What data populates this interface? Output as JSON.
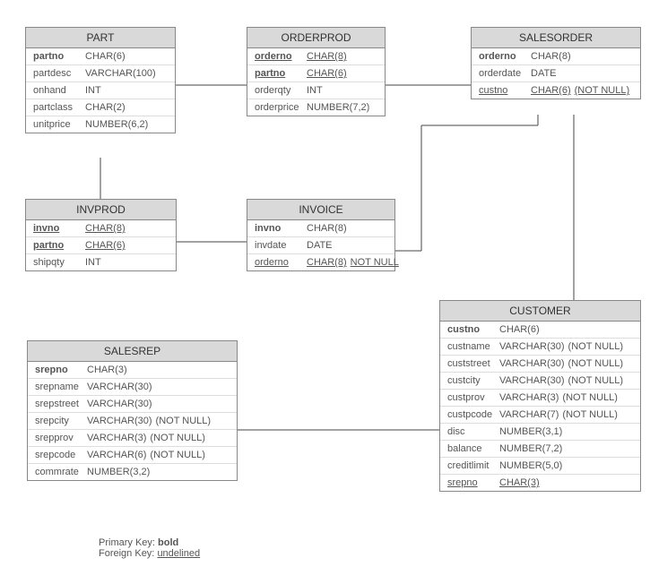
{
  "legend": {
    "pk_label": "Primary Key:",
    "pk_style": "bold",
    "fk_label": "Foreign Key:",
    "fk_style": "undelined"
  },
  "entities": {
    "part": {
      "title": "PART",
      "rows": [
        {
          "name": "partno",
          "type": "CHAR(6)",
          "extra": "",
          "pk": true,
          "fk": false
        },
        {
          "name": "partdesc",
          "type": "VARCHAR(100)",
          "extra": "",
          "pk": false,
          "fk": false
        },
        {
          "name": "onhand",
          "type": "INT",
          "extra": "",
          "pk": false,
          "fk": false
        },
        {
          "name": "partclass",
          "type": "CHAR(2)",
          "extra": "",
          "pk": false,
          "fk": false
        },
        {
          "name": "unitprice",
          "type": "NUMBER(6,2)",
          "extra": "",
          "pk": false,
          "fk": false
        }
      ]
    },
    "orderprod": {
      "title": "ORDERPROD",
      "rows": [
        {
          "name": "orderno",
          "type": "CHAR(8)",
          "extra": "",
          "pk": true,
          "fk": true
        },
        {
          "name": "partno",
          "type": "CHAR(6)",
          "extra": "",
          "pk": true,
          "fk": true
        },
        {
          "name": "orderqty",
          "type": "INT",
          "extra": "",
          "pk": false,
          "fk": false
        },
        {
          "name": "orderprice",
          "type": "NUMBER(7,2)",
          "extra": "",
          "pk": false,
          "fk": false
        }
      ]
    },
    "salesorder": {
      "title": "SALESORDER",
      "rows": [
        {
          "name": "orderno",
          "type": "CHAR(8)",
          "extra": "",
          "pk": true,
          "fk": false
        },
        {
          "name": "orderdate",
          "type": "DATE",
          "extra": "",
          "pk": false,
          "fk": false
        },
        {
          "name": "custno",
          "type": "CHAR(6)",
          "extra": "(NOT NULL)",
          "pk": false,
          "fk": true
        }
      ]
    },
    "invprod": {
      "title": "INVPROD",
      "rows": [
        {
          "name": "invno",
          "type": "CHAR(8)",
          "extra": "",
          "pk": true,
          "fk": true
        },
        {
          "name": "partno",
          "type": "CHAR(6)",
          "extra": "",
          "pk": true,
          "fk": true
        },
        {
          "name": "shipqty",
          "type": "INT",
          "extra": "",
          "pk": false,
          "fk": false
        }
      ]
    },
    "invoice": {
      "title": "INVOICE",
      "rows": [
        {
          "name": "invno",
          "type": "CHAR(8)",
          "extra": "",
          "pk": true,
          "fk": false
        },
        {
          "name": "invdate",
          "type": "DATE",
          "extra": "",
          "pk": false,
          "fk": false
        },
        {
          "name": "orderno",
          "type": "CHAR(8)",
          "extra": "NOT NULL",
          "pk": false,
          "fk": true
        }
      ]
    },
    "customer": {
      "title": "CUSTOMER",
      "rows": [
        {
          "name": "custno",
          "type": "CHAR(6)",
          "extra": "",
          "pk": true,
          "fk": false
        },
        {
          "name": "custname",
          "type": "VARCHAR(30)",
          "extra": "(NOT NULL)",
          "pk": false,
          "fk": false
        },
        {
          "name": "custstreet",
          "type": "VARCHAR(30)",
          "extra": "(NOT NULL)",
          "pk": false,
          "fk": false
        },
        {
          "name": "custcity",
          "type": "VARCHAR(30)",
          "extra": "(NOT NULL)",
          "pk": false,
          "fk": false
        },
        {
          "name": "custprov",
          "type": "VARCHAR(3)",
          "extra": "(NOT NULL)",
          "pk": false,
          "fk": false
        },
        {
          "name": "custpcode",
          "type": "VARCHAR(7)",
          "extra": "(NOT NULL)",
          "pk": false,
          "fk": false
        },
        {
          "name": "disc",
          "type": "NUMBER(3,1)",
          "extra": "",
          "pk": false,
          "fk": false
        },
        {
          "name": "balance",
          "type": "NUMBER(7,2)",
          "extra": "",
          "pk": false,
          "fk": false
        },
        {
          "name": "creditlimit",
          "type": "NUMBER(5,0)",
          "extra": "",
          "pk": false,
          "fk": false
        },
        {
          "name": "srepno",
          "type": "CHAR(3)",
          "extra": "",
          "pk": false,
          "fk": true
        }
      ]
    },
    "salesrep": {
      "title": "SALESREP",
      "rows": [
        {
          "name": "srepno",
          "type": "CHAR(3)",
          "extra": "",
          "pk": true,
          "fk": false
        },
        {
          "name": "srepname",
          "type": "VARCHAR(30)",
          "extra": "",
          "pk": false,
          "fk": false
        },
        {
          "name": "srepstreet",
          "type": "VARCHAR(30)",
          "extra": "",
          "pk": false,
          "fk": false
        },
        {
          "name": "srepcity",
          "type": "VARCHAR(30)",
          "extra": "(NOT NULL)",
          "pk": false,
          "fk": false
        },
        {
          "name": "srepprov",
          "type": "VARCHAR(3)",
          "extra": "(NOT NULL)",
          "pk": false,
          "fk": false
        },
        {
          "name": "srepcode",
          "type": "VARCHAR(6)",
          "extra": "(NOT NULL)",
          "pk": false,
          "fk": false
        },
        {
          "name": "commrate",
          "type": "NUMBER(3,2)",
          "extra": "",
          "pk": false,
          "fk": false
        }
      ]
    }
  },
  "relationships": [
    {
      "from": "PART",
      "to": "ORDERPROD",
      "type": "one-to-many"
    },
    {
      "from": "SALESORDER",
      "to": "ORDERPROD",
      "type": "one-to-many"
    },
    {
      "from": "PART",
      "to": "INVPROD",
      "type": "one-to-many"
    },
    {
      "from": "INVOICE",
      "to": "INVPROD",
      "type": "one-to-many"
    },
    {
      "from": "SALESORDER",
      "to": "INVOICE",
      "type": "one-to-many-optional"
    },
    {
      "from": "CUSTOMER",
      "to": "SALESORDER",
      "type": "one-to-many"
    },
    {
      "from": "SALESREP",
      "to": "CUSTOMER",
      "type": "one-to-many-optional"
    }
  ]
}
